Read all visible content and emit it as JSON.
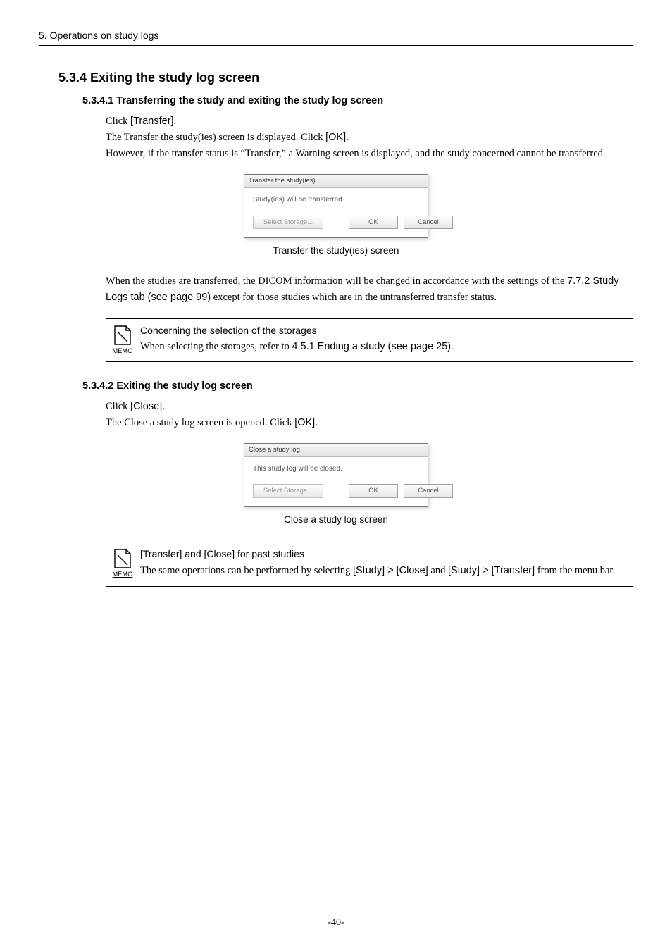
{
  "header": {
    "left": "5. Operations on study logs",
    "right": ""
  },
  "section534": {
    "heading": "5.3.4 Exiting the study log screen",
    "sub1": {
      "heading": "5.3.4.1 Transferring the study and exiting the study log screen",
      "p1_a": "Click ",
      "p1_b": "[Transfer]",
      "p1_c": ".",
      "p2_a": "The Transfer the study(ies) screen is displayed. Click ",
      "p2_b": "[OK]",
      "p2_c": ".",
      "p3": "However, if the transfer status is “Transfer,” a Warning screen is displayed, and the study concerned cannot be transferred.",
      "dialog": {
        "title": "Transfer the study(ies)",
        "message": "Study(ies) will be transferred.",
        "btn_select": "Select Storage...",
        "btn_ok": "OK",
        "btn_cancel": "Cancel"
      },
      "caption": "Transfer the study(ies) screen",
      "p4_a": "When the studies are transferred, the DICOM information will be changed in accordance with the settings of the ",
      "p4_b": "7.7.2 Study Logs tab (see page 99)",
      "p4_c": " except for those studies which are in the untransferred transfer status.",
      "memo": {
        "label": "MEMO",
        "title": "Concerning the selection of the storages",
        "body_a": "When selecting the storages, refer to ",
        "body_b": "4.5.1 Ending a study (see page 25)",
        "body_c": "."
      }
    },
    "sub2": {
      "heading": "5.3.4.2 Exiting the study log screen",
      "p1_a": "Click ",
      "p1_b": "[Close]",
      "p1_c": ".",
      "p2_a": "The Close a study log screen is opened. Click ",
      "p2_b": "[OK]",
      "p2_c": ".",
      "dialog": {
        "title": "Close a study log",
        "message": "This study log will be closed.",
        "btn_select": "Select Storage...",
        "btn_ok": "OK",
        "btn_cancel": "Cancel"
      },
      "caption": "Close a study log screen",
      "memo": {
        "label": "MEMO",
        "title": "[Transfer] and [Close] for past studies",
        "body_a": "The same operations can be performed by selecting ",
        "body_b": "[Study] > [Close]",
        "body_c": " and ",
        "body_d": "[Study] > [Transfer]",
        "body_e": " from the menu bar."
      }
    }
  },
  "footer": "-40-"
}
